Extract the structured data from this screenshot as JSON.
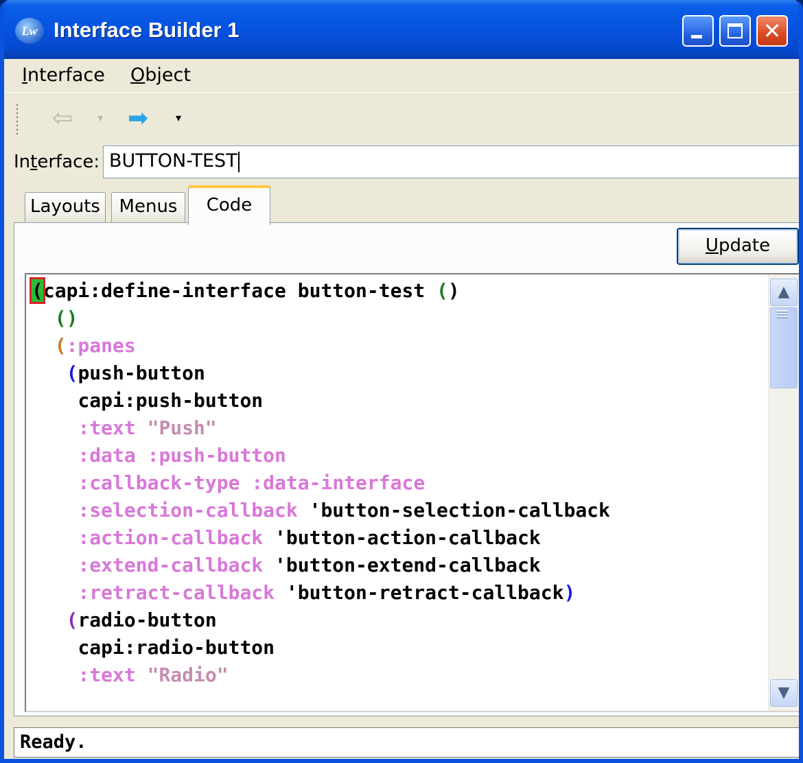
{
  "window": {
    "title": "Interface Builder 1",
    "icon": "lw-app-icon",
    "icon_text": "Lw",
    "controls": {
      "minimize": "minimize-icon",
      "maximize": "maximize-icon",
      "close": "close-icon",
      "close_glyph": "✕"
    }
  },
  "menubar": {
    "items": [
      {
        "label": "Interface",
        "underline": "I",
        "rest": "nterface"
      },
      {
        "label": "Object",
        "underline": "O",
        "rest": "bject"
      }
    ]
  },
  "toolbar": {
    "back": {
      "icon": "back-arrow-icon",
      "glyph": "⇦",
      "enabled": false
    },
    "back_dropdown": "▾",
    "forward": {
      "icon": "forward-arrow-icon",
      "glyph": "➡",
      "enabled": true
    },
    "forward_dropdown": "▾"
  },
  "interface_field": {
    "label_pre": "In",
    "label_ul": "t",
    "label_post": "erface:",
    "value": "BUTTON-TEST"
  },
  "tabs": [
    {
      "label": "Layouts",
      "active": false
    },
    {
      "label": "Menus",
      "active": false
    },
    {
      "label": "Code",
      "active": true
    }
  ],
  "update_button": {
    "underline": "U",
    "rest": "pdate"
  },
  "code": {
    "lines": [
      "(capi:define-interface button-test ()",
      "  ()",
      "  (:panes",
      "   (push-button",
      "    capi:push-button",
      "    :text \"Push\"",
      "    :data :push-button",
      "    :callback-type :data-interface",
      "    :selection-callback 'button-selection-callback",
      "    :action-callback 'button-action-callback",
      "    :extend-callback 'button-extend-callback",
      "    :retract-callback 'button-retract-callback)",
      "   (radio-button",
      "    capi:radio-button",
      "    :text \"Radio\""
    ]
  },
  "scrollbar": {
    "up": "▲",
    "down": "▼"
  },
  "status": "Ready."
}
